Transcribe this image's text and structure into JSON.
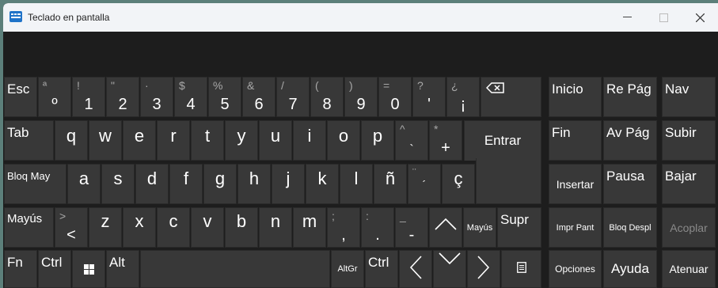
{
  "window": {
    "title": "Teclado en pantalla"
  },
  "keys": {
    "esc": "Esc",
    "n1_top": "ª",
    "n1_bot": "º",
    "n2_top": "!",
    "n2_bot": "1",
    "n3_top": "\"",
    "n3_bot": "2",
    "n4_top": "·",
    "n4_bot": "3",
    "n5_top": "$",
    "n5_bot": "4",
    "n6_top": "%",
    "n6_bot": "5",
    "n7_top": "&",
    "n7_bot": "6",
    "n8_top": "/",
    "n8_bot": "7",
    "n9_top": "(",
    "n9_bot": "8",
    "n10_top": ")",
    "n10_bot": "9",
    "n11_top": "=",
    "n11_bot": "0",
    "n12_top": "?",
    "n12_bot": "'",
    "n13_top": "¿",
    "n13_bot": "¡",
    "tab": "Tab",
    "q": "q",
    "w": "w",
    "e": "e",
    "r": "r",
    "t": "t",
    "y": "y",
    "u": "u",
    "i": "i",
    "o": "o",
    "p": "p",
    "grave_top": "^",
    "grave_bot": "`",
    "plus_top": "*",
    "plus_bot": "+",
    "enter": "Entrar",
    "caps": "Bloq May",
    "a": "a",
    "s": "s",
    "d": "d",
    "f": "f",
    "g": "g",
    "h": "h",
    "j": "j",
    "k": "k",
    "l": "l",
    "ntilde": "ñ",
    "acute_top": "¨",
    "acute_bot": "´",
    "cedilla": "ç",
    "lshift": "Mayús",
    "lt_top": ">",
    "lt_bot": "<",
    "z": "z",
    "x": "x",
    "c": "c",
    "v": "v",
    "b": "b",
    "n": "n",
    "m": "m",
    "comma_top": ";",
    "comma_bot": ",",
    "period_top": ":",
    "period_bot": ".",
    "minus_top": "_",
    "minus_bot": "-",
    "rshift": "Mayús",
    "supr": "Supr",
    "fn": "Fn",
    "ctrl": "Ctrl",
    "alt": "Alt",
    "altgr": "AltGr",
    "rctrl": "Ctrl",
    "inicio": "Inicio",
    "repag": "Re Pág",
    "nav": "Nav",
    "fin": "Fin",
    "avpag": "Av Pág",
    "subir": "Subir",
    "insertar": "Insertar",
    "pausa": "Pausa",
    "bajar": "Bajar",
    "imprpant": "Impr Pant",
    "bloqdespl": "Bloq Despl",
    "acoplar": "Acoplar",
    "opciones": "Opciones",
    "ayuda": "Ayuda",
    "atenuar": "Atenuar"
  }
}
